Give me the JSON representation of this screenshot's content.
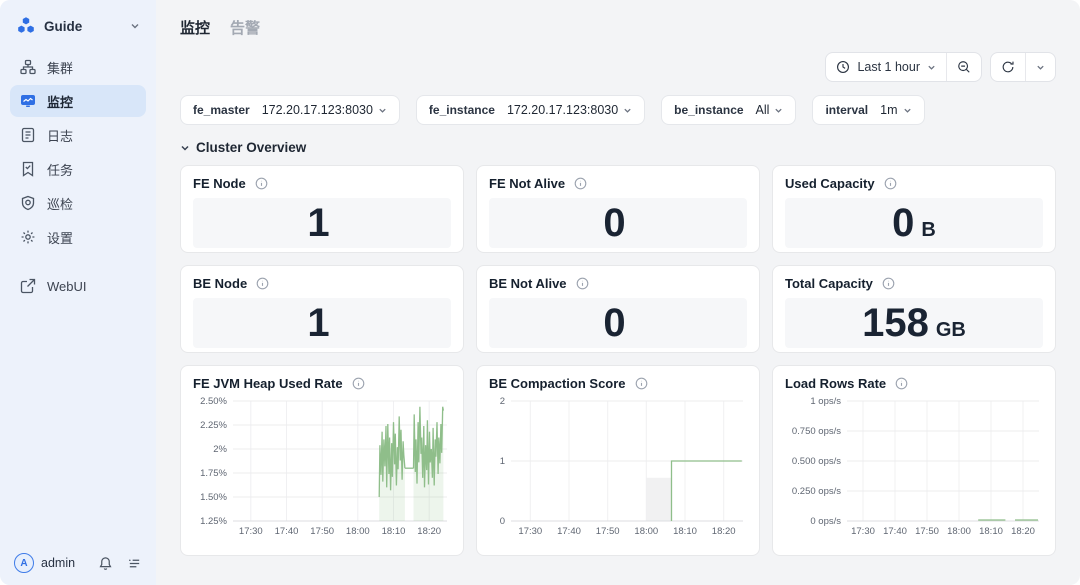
{
  "colors": {
    "accent": "#2f6fe4",
    "selected_pill": "#d8e6f9",
    "sidebar_bg": "#edf2fb",
    "line_green": "#8fbe8a",
    "value_text": "#1a2433"
  },
  "sidebar": {
    "brand": {
      "label": "Guide"
    },
    "items": [
      {
        "label": "集群",
        "icon": "cluster-icon",
        "active": false
      },
      {
        "label": "监控",
        "icon": "monitor-icon",
        "active": true
      },
      {
        "label": "日志",
        "icon": "log-icon",
        "active": false
      },
      {
        "label": "任务",
        "icon": "task-icon",
        "active": false
      },
      {
        "label": "巡检",
        "icon": "inspection-icon",
        "active": false
      },
      {
        "label": "设置",
        "icon": "settings-icon",
        "active": false
      }
    ],
    "webui": {
      "label": "WebUI",
      "icon": "external-link-icon"
    },
    "user": {
      "name": "admin",
      "avatar_initial": "A"
    }
  },
  "header": {
    "tabs": [
      {
        "label": "监控",
        "active": true
      },
      {
        "label": "告警",
        "active": false
      }
    ]
  },
  "toolbar": {
    "time_range_label": "Last 1 hour"
  },
  "filters": [
    {
      "label": "fe_master",
      "value": "172.20.17.123:8030"
    },
    {
      "label": "fe_instance",
      "value": "172.20.17.123:8030"
    },
    {
      "label": "be_instance",
      "value": "All"
    },
    {
      "label": "interval",
      "value": "1m"
    }
  ],
  "section": {
    "title": "Cluster Overview"
  },
  "stats": [
    {
      "title": "FE Node",
      "value": "1",
      "unit": ""
    },
    {
      "title": "FE Not Alive",
      "value": "0",
      "unit": ""
    },
    {
      "title": "Used Capacity",
      "value": "0",
      "unit": "B"
    },
    {
      "title": "BE Node",
      "value": "1",
      "unit": ""
    },
    {
      "title": "BE Not Alive",
      "value": "0",
      "unit": ""
    },
    {
      "title": "Total Capacity",
      "value": "158",
      "unit": "GB"
    }
  ],
  "chart_data": [
    {
      "type": "line",
      "title": "FE JVM Heap Used Rate",
      "x_ticks": [
        "17:30",
        "17:40",
        "17:50",
        "18:00",
        "18:10",
        "18:20"
      ],
      "x_tick_minutes": [
        5,
        15,
        25,
        35,
        45,
        55
      ],
      "x_domain": [
        0,
        60
      ],
      "x_domain_note": "minutes after 17:25; data spans approx 18:06-18:24",
      "y_domain": [
        1.25,
        2.5
      ],
      "y_ticks": [
        {
          "v": 2.5,
          "label": "2.50%"
        },
        {
          "v": 2.25,
          "label": "2.25%"
        },
        {
          "v": 2.0,
          "label": "2%"
        },
        {
          "v": 1.75,
          "label": "1.75%"
        },
        {
          "v": 1.5,
          "label": "1.50%"
        },
        {
          "v": 1.25,
          "label": "1.25%"
        }
      ],
      "ml": 40,
      "line_color": "#8fbe8a",
      "grid": true,
      "legend": "none",
      "segments": [
        {
          "fill": true,
          "points": [
            [
              41.0,
              1.5
            ],
            [
              41.2,
              2.04
            ],
            [
              41.5,
              1.73
            ],
            [
              41.8,
              2.18
            ],
            [
              42.0,
              1.66
            ],
            [
              42.3,
              2.1
            ],
            [
              42.6,
              1.82
            ],
            [
              42.9,
              2.24
            ],
            [
              43.1,
              1.6
            ],
            [
              43.4,
              2.26
            ],
            [
              43.7,
              1.74
            ],
            [
              43.9,
              2.12
            ],
            [
              44.2,
              1.57
            ],
            [
              44.5,
              2.06
            ],
            [
              44.7,
              1.71
            ],
            [
              45.0,
              2.28
            ],
            [
              45.3,
              1.84
            ],
            [
              45.5,
              2.16
            ],
            [
              45.8,
              1.62
            ],
            [
              46.1,
              2.02
            ],
            [
              46.3,
              1.79
            ],
            [
              46.6,
              2.34
            ],
            [
              46.9,
              1.88
            ],
            [
              47.1,
              2.2
            ],
            [
              47.4,
              1.68
            ],
            [
              47.7,
              2.08
            ],
            [
              47.9,
              1.94
            ],
            [
              48.2,
              1.8
            ]
          ]
        },
        {
          "fill": false,
          "points": [
            [
              48.2,
              1.8
            ],
            [
              50.6,
              1.8
            ]
          ]
        },
        {
          "fill": true,
          "points": [
            [
              50.6,
              1.8
            ],
            [
              50.8,
              2.36
            ],
            [
              51.1,
              1.76
            ],
            [
              51.3,
              2.1
            ],
            [
              51.6,
              1.64
            ],
            [
              51.9,
              2.28
            ],
            [
              52.1,
              1.86
            ],
            [
              52.4,
              2.44
            ],
            [
              52.7,
              1.95
            ],
            [
              52.9,
              2.12
            ],
            [
              53.2,
              1.7
            ],
            [
              53.5,
              2.24
            ],
            [
              53.7,
              1.6
            ],
            [
              54.0,
              2.04
            ],
            [
              54.3,
              1.78
            ],
            [
              54.5,
              2.3
            ],
            [
              54.8,
              1.63
            ],
            [
              55.1,
              2.18
            ],
            [
              55.3,
              1.86
            ],
            [
              55.6,
              2.0
            ],
            [
              55.9,
              1.7
            ],
            [
              56.1,
              2.22
            ],
            [
              56.4,
              1.62
            ],
            [
              56.7,
              2.1
            ],
            [
              56.9,
              1.92
            ],
            [
              57.2,
              2.28
            ],
            [
              57.5,
              1.74
            ],
            [
              57.7,
              2.12
            ],
            [
              58.0,
              1.85
            ],
            [
              58.3,
              2.26
            ],
            [
              58.5,
              1.96
            ],
            [
              58.8,
              2.44
            ],
            [
              59.0,
              2.4
            ]
          ]
        }
      ]
    },
    {
      "type": "line",
      "title": "BE Compaction Score",
      "x_ticks": [
        "17:30",
        "17:40",
        "17:50",
        "18:00",
        "18:10",
        "18:20"
      ],
      "x_tick_minutes": [
        5,
        15,
        25,
        35,
        45,
        55
      ],
      "x_domain": [
        0,
        60
      ],
      "y_domain": [
        0,
        2
      ],
      "y_ticks": [
        {
          "v": 2,
          "label": "2"
        },
        {
          "v": 1,
          "label": "1"
        },
        {
          "v": 0,
          "label": "0"
        }
      ],
      "ml": 22,
      "line_color": "#8fbe8a",
      "grid": true,
      "legend": "none",
      "rects": [
        {
          "x0": 35,
          "x1": 41.5,
          "y0": 0,
          "y1": 0.72,
          "color": "#f1f1f2"
        }
      ],
      "segments": [
        {
          "fill": false,
          "points": [
            [
              41.5,
              0
            ],
            [
              41.5,
              1
            ],
            [
              59.7,
              1
            ]
          ]
        }
      ]
    },
    {
      "type": "line",
      "title": "Load Rows Rate",
      "x_ticks": [
        "17:30",
        "17:40",
        "17:50",
        "18:00",
        "18:10",
        "18:20"
      ],
      "x_tick_minutes": [
        5,
        15,
        25,
        35,
        45,
        55
      ],
      "x_domain": [
        0,
        60
      ],
      "y_domain": [
        0,
        1
      ],
      "y_ticks": [
        {
          "v": 1,
          "label": "1 ops/s"
        },
        {
          "v": 0.75,
          "label": "0.750 ops/s"
        },
        {
          "v": 0.5,
          "label": "0.500 ops/s"
        },
        {
          "v": 0.25,
          "label": "0.250 ops/s"
        },
        {
          "v": 0,
          "label": "0 ops/s"
        }
      ],
      "ml": 62,
      "line_color": "#8fbe8a",
      "grid": true,
      "legend": "none",
      "segments": [
        {
          "fill": false,
          "points": [
            [
              41,
              0.008
            ],
            [
              49.5,
              0.008
            ]
          ]
        },
        {
          "fill": false,
          "points": [
            [
              52.5,
              0.008
            ],
            [
              59.7,
              0.008
            ]
          ]
        }
      ]
    }
  ]
}
